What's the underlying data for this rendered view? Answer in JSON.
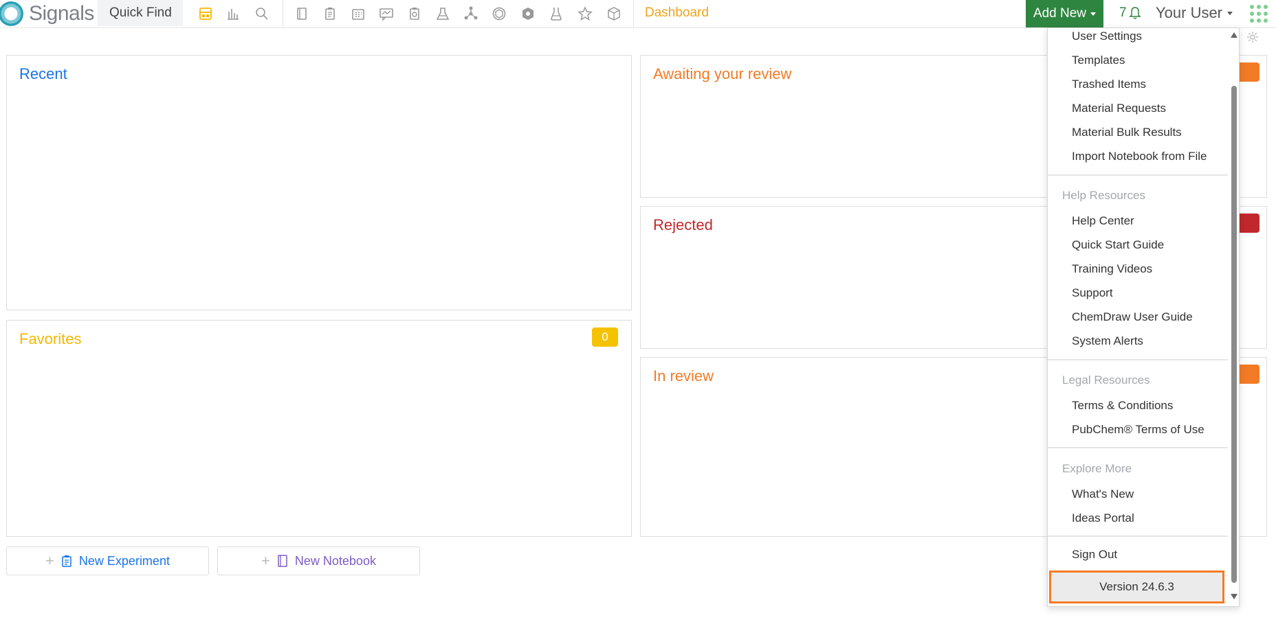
{
  "header": {
    "brand": "Signals",
    "quick_find": "Quick Find",
    "breadcrumb": "Dashboard",
    "add_new": "Add New",
    "notification_count": "7",
    "user": "Your User"
  },
  "toolbar_icons": [
    "dashboard-icon",
    "analytics-icon",
    "search-icon",
    "notebook-icon",
    "experiment-icon",
    "calendar-icon",
    "chat-icon",
    "clipboard-icon",
    "flask-icon",
    "molecule-icon",
    "hexagon-icon",
    "shield-icon",
    "beaker-icon",
    "star-icon",
    "cube-icon"
  ],
  "colors": {
    "primary_green": "#2e8540",
    "recent_blue": "#1a73e8",
    "favorites_yellow": "#f5b800",
    "awaiting_orange": "#f47b25",
    "rejected_red": "#c0282d",
    "notebook_purple": "#7b5cc4",
    "version_border": "#f47b25"
  },
  "panels": {
    "recent": {
      "title": "Recent"
    },
    "favorites": {
      "title": "Favorites",
      "count": "0"
    },
    "awaiting": {
      "title": "Awaiting your review"
    },
    "rejected": {
      "title": "Rejected"
    },
    "in_review": {
      "title": "In review"
    }
  },
  "actions": {
    "new_experiment": "New Experiment",
    "new_notebook": "New Notebook"
  },
  "menu": {
    "items_top": [
      "User Settings",
      "Templates",
      "Trashed Items",
      "Material Requests",
      "Material Bulk Results",
      "Import Notebook from File"
    ],
    "help_header": "Help Resources",
    "help_items": [
      "Help Center",
      "Quick Start Guide",
      "Training Videos",
      "Support",
      "ChemDraw User Guide",
      "System Alerts"
    ],
    "legal_header": "Legal Resources",
    "legal_items": [
      "Terms & Conditions",
      "PubChem® Terms of Use"
    ],
    "explore_header": "Explore More",
    "explore_items": [
      "What's New",
      "Ideas Portal"
    ],
    "sign_out": "Sign Out",
    "version": "Version 24.6.3"
  }
}
